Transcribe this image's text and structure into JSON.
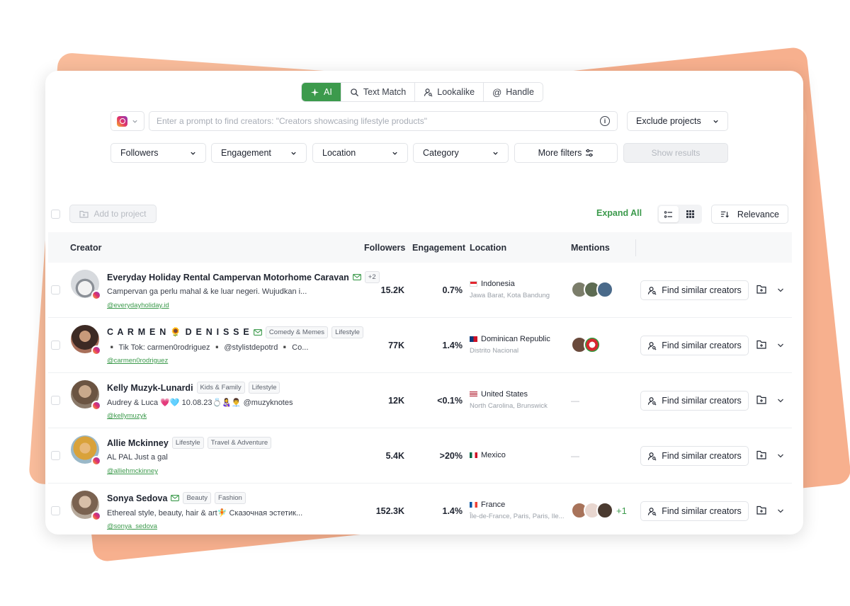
{
  "search_tabs": [
    {
      "label": "AI",
      "icon": "sparkle-icon",
      "active": true
    },
    {
      "label": "Text Match",
      "icon": "search-icon",
      "active": false
    },
    {
      "label": "Lookalike",
      "icon": "person-search-icon",
      "active": false
    },
    {
      "label": "Handle",
      "icon": "at-icon",
      "active": false
    }
  ],
  "prompt": {
    "placeholder": "Enter a prompt to find creators: \"Creators showcasing lifestyle products\""
  },
  "exclude_projects": "Exclude projects",
  "filters": {
    "followers": "Followers",
    "engagement": "Engagement",
    "location": "Location",
    "category": "Category",
    "more": "More filters",
    "show_results": "Show results"
  },
  "toolbar": {
    "add_to_project": "Add to project",
    "expand_all": "Expand All",
    "sort": "Relevance"
  },
  "columns": {
    "creator": "Creator",
    "followers": "Followers",
    "engagement": "Engagement",
    "location": "Location",
    "mentions": "Mentions"
  },
  "find_similar_label": "Find similar creators",
  "creators": [
    {
      "name": "Everyday Holiday Rental Campervan Motorhome Caravan",
      "tags": [
        "+2"
      ],
      "bio": "Campervan ga perlu mahal & ke luar negeri. Wujudkan i...",
      "handle": "@everydayholiday.id",
      "followers": "15.2K",
      "engagement": "0.7%",
      "country": "Indonesia",
      "region": "Jawa Barat, Kota Bandung",
      "mentions_extra": ""
    },
    {
      "name": "C A R M E N 🌻 D E N I S S E",
      "tags": [
        "Comedy & Memes",
        "Lifestyle"
      ],
      "bio": "▪️ Tik Tok: carmen0rodriguez ▪️ @stylistdepotrd ▪️ Co...",
      "handle": "@carmen0rodriguez",
      "followers": "77K",
      "engagement": "1.4%",
      "country": "Dominican Republic",
      "region": "Distrito Nacional",
      "mentions_extra": ""
    },
    {
      "name": "Kelly Muzyk-Lunardi",
      "tags": [
        "Kids & Family",
        "Lifestyle"
      ],
      "bio": "Audrey & Luca 💗🩵 10.08.23💍👩‍🍼👨‍💼 @muzyknotes",
      "handle": "@kellymuzyk",
      "followers": "12K",
      "engagement": "<0.1%",
      "country": "United States",
      "region": "North Carolina, Brunswick",
      "mentions_extra": "—"
    },
    {
      "name": "Allie Mckinney",
      "tags": [
        "Lifestyle",
        "Travel & Adventure"
      ],
      "bio": "AL PAL Just a gal",
      "handle": "@alliehmckinney",
      "followers": "5.4K",
      "engagement": ">20%",
      "country": "Mexico",
      "region": "",
      "mentions_extra": "—"
    },
    {
      "name": "Sonya Sedova",
      "tags": [
        "Beauty",
        "Fashion"
      ],
      "bio": "Ethereal style, beauty, hair & art🧚 Сказочная эстетик...",
      "handle": "@sonya_sedova",
      "followers": "152.3K",
      "engagement": "1.4%",
      "country": "France",
      "region": "Île-de-France, Paris, Paris, Ile...",
      "mentions_extra": "+1"
    }
  ],
  "colors": {
    "accent": "#3c9a4c",
    "backdrop": "#f7b08e"
  }
}
